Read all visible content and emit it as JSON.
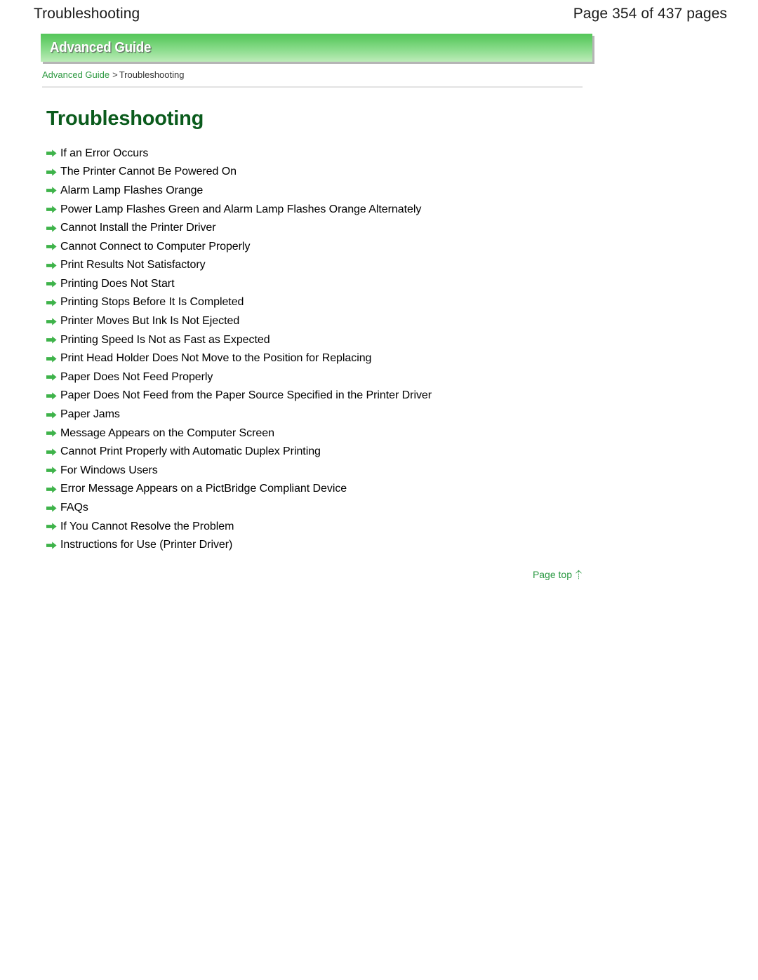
{
  "page_header": {
    "title": "Troubleshooting",
    "page_count": "Page 354 of 437 pages"
  },
  "banner": {
    "label": "Advanced Guide"
  },
  "breadcrumb": {
    "root": "Advanced Guide",
    "separator": ">",
    "current": "Troubleshooting"
  },
  "content": {
    "title": "Troubleshooting",
    "links": [
      {
        "label": "If an Error Occurs",
        "icon": "arrow-right-icon"
      },
      {
        "label": "The Printer Cannot Be Powered On",
        "icon": "arrow-right-icon"
      },
      {
        "label": "Alarm Lamp Flashes Orange",
        "icon": "arrow-right-icon"
      },
      {
        "label": "Power Lamp Flashes Green and Alarm Lamp Flashes Orange Alternately",
        "icon": "arrow-right-icon"
      },
      {
        "label": "Cannot Install the Printer Driver",
        "icon": "arrow-right-icon"
      },
      {
        "label": "Cannot Connect to Computer Properly",
        "icon": "arrow-right-icon"
      },
      {
        "label": "Print Results Not Satisfactory",
        "icon": "arrow-right-icon"
      },
      {
        "label": "Printing Does Not Start",
        "icon": "arrow-right-icon"
      },
      {
        "label": "Printing Stops Before It Is Completed",
        "icon": "arrow-right-icon"
      },
      {
        "label": "Printer Moves But Ink Is Not Ejected",
        "icon": "arrow-right-icon"
      },
      {
        "label": "Printing Speed Is Not as Fast as Expected",
        "icon": "arrow-right-icon"
      },
      {
        "label": "Print Head Holder Does Not Move to the Position for Replacing",
        "icon": "arrow-right-icon"
      },
      {
        "label": "Paper Does Not Feed Properly",
        "icon": "arrow-right-icon"
      },
      {
        "label": "Paper Does Not Feed from the Paper Source Specified in the Printer Driver",
        "icon": "arrow-right-icon"
      },
      {
        "label": "Paper Jams",
        "icon": "arrow-right-icon"
      },
      {
        "label": "Message Appears on the Computer Screen",
        "icon": "arrow-right-icon"
      },
      {
        "label": "Cannot Print Properly with Automatic Duplex Printing",
        "icon": "arrow-right-icon"
      },
      {
        "label": "For Windows Users",
        "icon": "arrow-right-icon"
      },
      {
        "label": "Error Message Appears on a PictBridge Compliant Device",
        "icon": "arrow-right-icon"
      },
      {
        "label": "FAQs",
        "icon": "arrow-right-icon"
      },
      {
        "label": "If You Cannot Resolve the Problem",
        "icon": "arrow-right-icon"
      },
      {
        "label": "Instructions for Use (Printer Driver)",
        "icon": "arrow-right-icon"
      }
    ]
  },
  "page_top": {
    "label": "Page top",
    "icon": "arrow-up-icon"
  },
  "colors": {
    "link_green": "#2a9942",
    "title_green": "#0a5b1c",
    "banner_green_top": "#55c65a",
    "banner_green_bottom": "#bdecb9",
    "rule_gray": "#e2e2e2"
  }
}
